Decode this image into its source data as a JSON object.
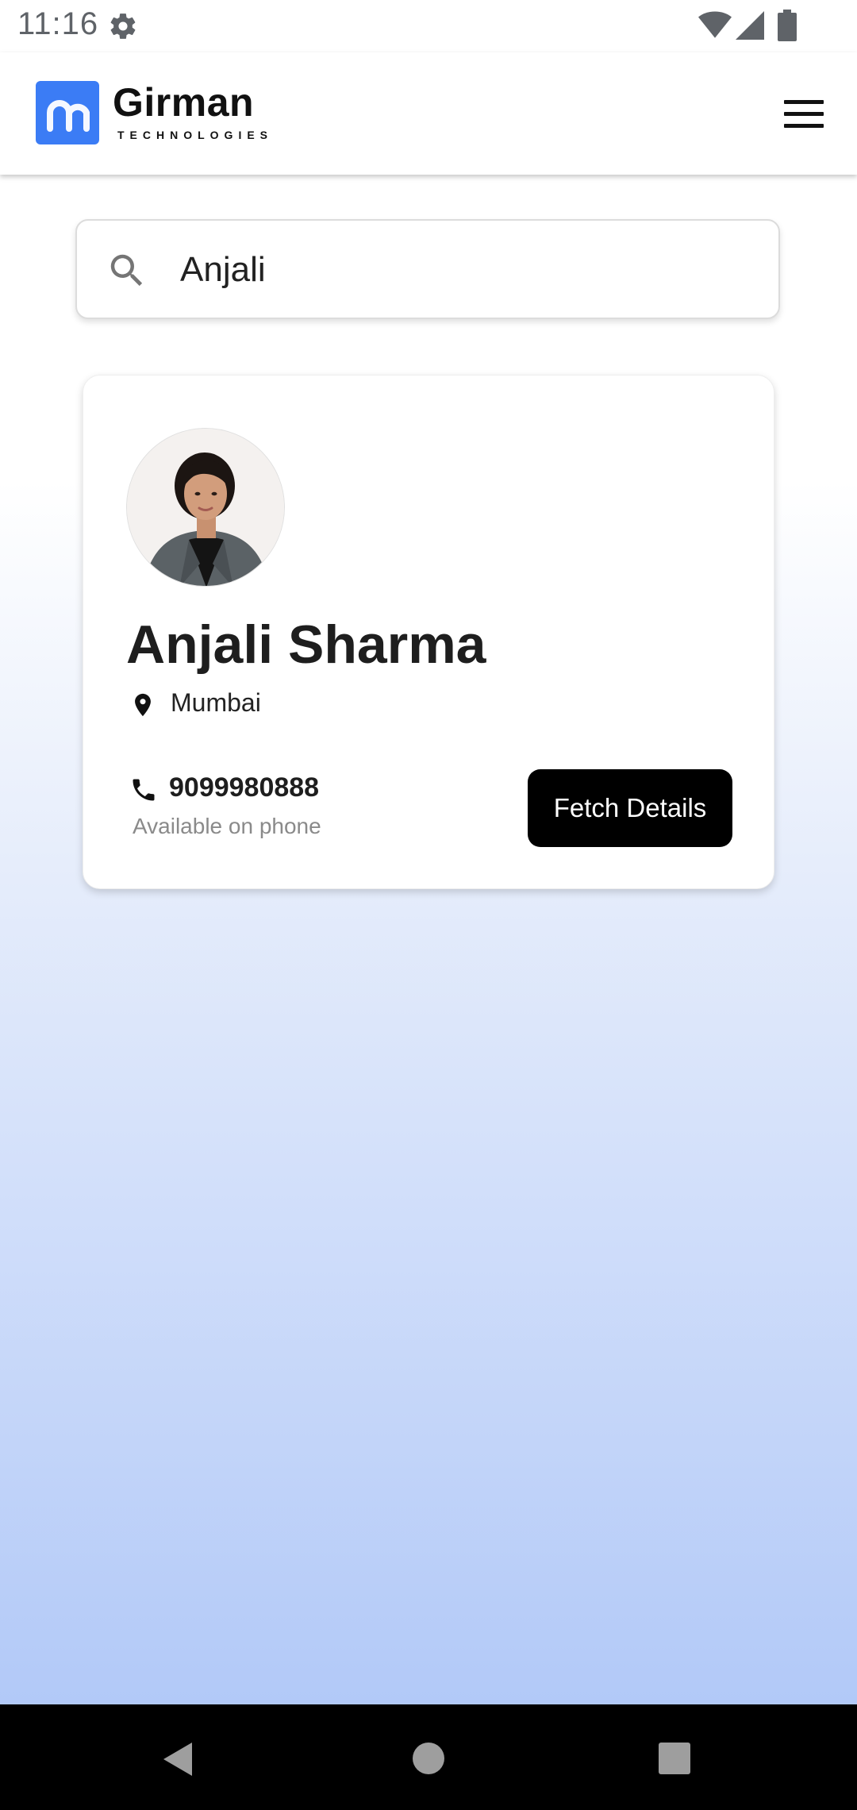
{
  "status_bar": {
    "time": "11:16",
    "icons": [
      "gear-icon",
      "wifi-icon",
      "signal-icon",
      "battery-icon"
    ]
  },
  "header": {
    "brand_name": "Girman",
    "brand_tagline": "TECHNOLOGIES",
    "brand_color": "#3b7cf5",
    "menu_icon": "hamburger-menu-icon"
  },
  "search": {
    "value": "Anjali",
    "placeholder": "",
    "icon": "search-icon"
  },
  "result_card": {
    "name": "Anjali Sharma",
    "location": "Mumbai",
    "phone": "9099980888",
    "phone_status": "Available on phone",
    "button_label": "Fetch Details",
    "avatar": "avatar-photo"
  },
  "colors": {
    "gradient_bottom": "#b2c9f8",
    "button_bg": "#000000",
    "button_text": "#ffffff"
  },
  "navigation": {
    "icons": [
      "back-icon",
      "home-icon",
      "recents-icon"
    ]
  }
}
